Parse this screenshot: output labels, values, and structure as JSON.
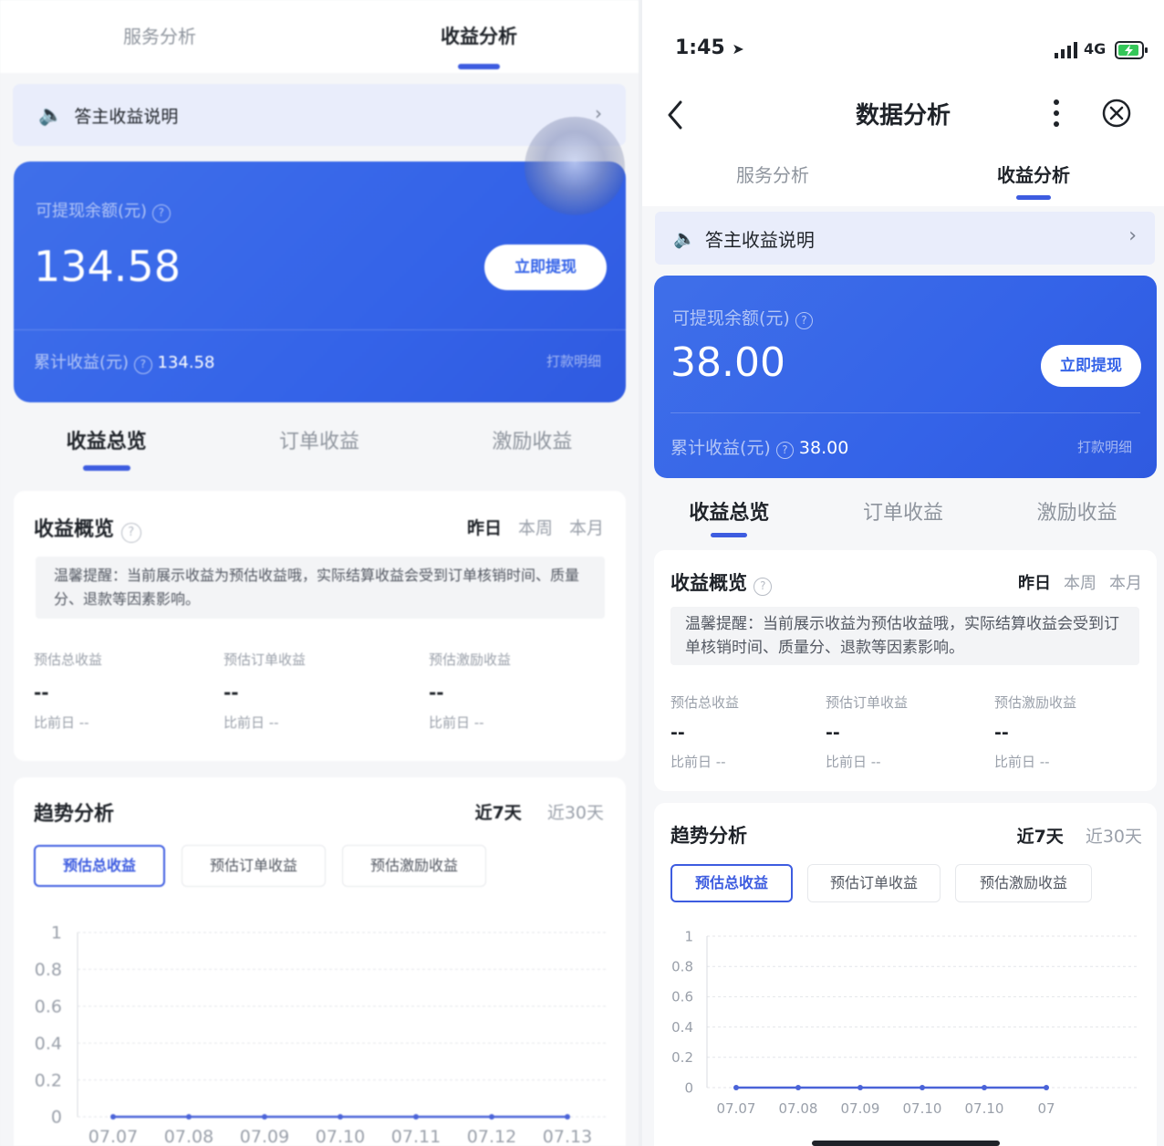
{
  "tabs": [
    "服务分析",
    "收益分析"
  ],
  "notice": {
    "text": "答主收益说明"
  },
  "left": {
    "balance": {
      "label": "可提现余额(元)",
      "amount": "134.58",
      "button": "立即提现",
      "cumulative_label": "累计收益(元)",
      "cumulative_value": "134.58",
      "detail_link": "打款明细"
    }
  },
  "right": {
    "status": {
      "time": "1:45",
      "network": "4G"
    },
    "nav_title": "数据分析",
    "balance": {
      "label": "可提现余额(元)",
      "amount": "38.00",
      "button": "立即提现",
      "cumulative_label": "累计收益(元)",
      "cumulative_value": "38.00",
      "detail_link": "打款明细"
    }
  },
  "sub_tabs": [
    "收益总览",
    "订单收益",
    "激励收益"
  ],
  "overview": {
    "title": "收益概览",
    "periods": [
      "昨日",
      "本周",
      "本月"
    ],
    "tip": "温馨提醒：当前展示收益为预估收益哦，实际结算收益会受到订单核销时间、质量分、退款等因素影响。",
    "metrics": [
      {
        "label": "预估总收益",
        "value": "--",
        "compare": "比前日 --"
      },
      {
        "label": "预估订单收益",
        "value": "--",
        "compare": "比前日 --"
      },
      {
        "label": "预估激励收益",
        "value": "--",
        "compare": "比前日 --"
      }
    ]
  },
  "trend": {
    "title": "趋势分析",
    "ranges": [
      "近7天",
      "近30天"
    ],
    "pills": [
      "预估总收益",
      "预估订单收益",
      "预估激励收益"
    ]
  },
  "chart_data": [
    {
      "type": "line",
      "title": "",
      "x": [
        "07.07",
        "07.08",
        "07.09",
        "07.10",
        "07.11",
        "07.12",
        "07.13"
      ],
      "series": [
        {
          "values": [
            0,
            0,
            0,
            0,
            0,
            0,
            0
          ]
        }
      ],
      "yticks": [
        "0",
        "0.2",
        "0.4",
        "0.6",
        "0.8",
        "1"
      ],
      "ylim": [
        0,
        1
      ],
      "grid": true,
      "line_color": "#4a63d8"
    },
    {
      "type": "line",
      "title": "",
      "x": [
        "07.07",
        "07.08",
        "07.09",
        "07.10",
        "07.10",
        "07"
      ],
      "series": [
        {
          "values": [
            0,
            0,
            0,
            0,
            0,
            0
          ]
        }
      ],
      "yticks": [
        "0",
        "0.2",
        "0.4",
        "0.6",
        "0.8",
        "1"
      ],
      "ylim": [
        0,
        1
      ],
      "grid": true,
      "line_color": "#4a63d8"
    }
  ]
}
